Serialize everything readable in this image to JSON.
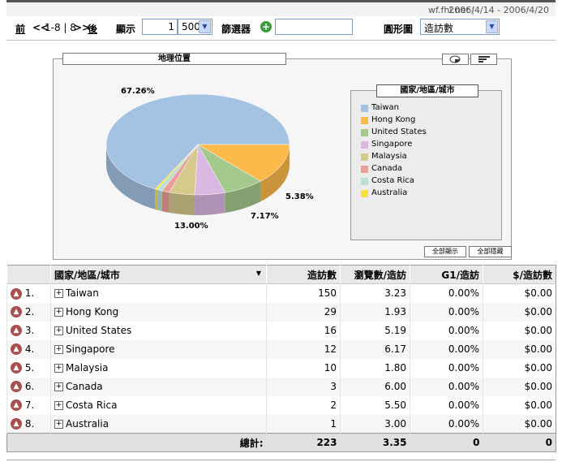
{
  "header": {
    "site": "wf.fhl.net",
    "separator": "|",
    "date_range": "2006/4/14 - 2006/4/20"
  },
  "toolbar": {
    "prev_label": "前",
    "prev_arrow": "<<",
    "range": "1-8 | 8",
    "next_arrow": ">>",
    "next_label": "後",
    "show_label": "顯示",
    "start_value": "1",
    "per_page": "500",
    "filter_label": "篩選器",
    "filter_value": "",
    "chart_label": "圓形圖",
    "chart_metric": "造訪數"
  },
  "chart": {
    "tab_title": "地理位置",
    "legend_title": "國家/地區/城市",
    "show_all": "全部顯示",
    "hide_all": "全部隱藏",
    "labels": [
      "67.26%",
      "13.00%",
      "7.17%",
      "5.38%"
    ],
    "legend": [
      {
        "name": "Taiwan",
        "color": "#a4c2e2"
      },
      {
        "name": "Hong Kong",
        "color": "#fdb94a"
      },
      {
        "name": "United States",
        "color": "#a4c98c"
      },
      {
        "name": "Singapore",
        "color": "#d9b8e2"
      },
      {
        "name": "Malaysia",
        "color": "#d6c98c"
      },
      {
        "name": "Canada",
        "color": "#e8a098"
      },
      {
        "name": "Costa Rica",
        "color": "#b8e0d8"
      },
      {
        "name": "Australia",
        "color": "#f8e040"
      }
    ]
  },
  "chart_data": {
    "type": "pie",
    "title": "地理位置",
    "categories": [
      "Taiwan",
      "Hong Kong",
      "United States",
      "Singapore",
      "Malaysia",
      "Canada",
      "Costa Rica",
      "Australia"
    ],
    "values": [
      67.26,
      13.0,
      7.17,
      5.38,
      4.48,
      1.35,
      0.9,
      0.45
    ],
    "data_labels": [
      "67.26%",
      "13.00%",
      "7.17%",
      "5.38%"
    ],
    "legend_title": "國家/地區/城市",
    "legend_position": "right"
  },
  "table": {
    "headers": {
      "country": "國家/地區/城市",
      "visits": "造訪數",
      "pages": "瀏覽數/造訪",
      "g1": "G1/造訪",
      "dollar": "$/造訪數"
    },
    "rows": [
      {
        "rank": "1.",
        "name": "Taiwan",
        "visits": "150",
        "pages": "3.23",
        "g1": "0.00%",
        "dollar": "$0.00"
      },
      {
        "rank": "2.",
        "name": "Hong Kong",
        "visits": "29",
        "pages": "1.93",
        "g1": "0.00%",
        "dollar": "$0.00"
      },
      {
        "rank": "3.",
        "name": "United States",
        "visits": "16",
        "pages": "5.19",
        "g1": "0.00%",
        "dollar": "$0.00"
      },
      {
        "rank": "4.",
        "name": "Singapore",
        "visits": "12",
        "pages": "6.17",
        "g1": "0.00%",
        "dollar": "$0.00"
      },
      {
        "rank": "5.",
        "name": "Malaysia",
        "visits": "10",
        "pages": "1.80",
        "g1": "0.00%",
        "dollar": "$0.00"
      },
      {
        "rank": "6.",
        "name": "Canada",
        "visits": "3",
        "pages": "6.00",
        "g1": "0.00%",
        "dollar": "$0.00"
      },
      {
        "rank": "7.",
        "name": "Costa Rica",
        "visits": "2",
        "pages": "5.50",
        "g1": "0.00%",
        "dollar": "$0.00"
      },
      {
        "rank": "8.",
        "name": "Australia",
        "visits": "1",
        "pages": "3.00",
        "g1": "0.00%",
        "dollar": "$0.00"
      }
    ],
    "total": {
      "label": "總計:",
      "visits": "223",
      "pages": "3.35",
      "g1": "0",
      "dollar": "0"
    }
  }
}
